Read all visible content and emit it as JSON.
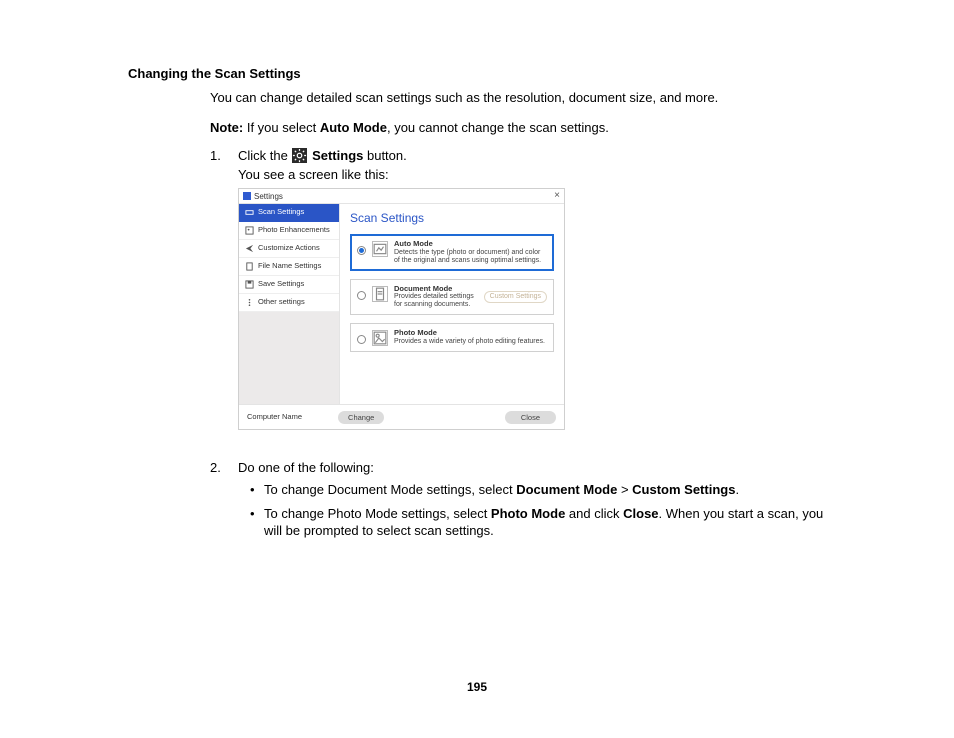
{
  "doc": {
    "heading": "Changing the Scan Settings",
    "intro": "You can change detailed scan settings such as the resolution, document size, and more.",
    "note_label": "Note:",
    "note_before": " If you select ",
    "note_bold": "Auto Mode",
    "note_after": ", you cannot change the scan settings.",
    "step1_num": "1.",
    "step1_a": "Click the ",
    "step1_b": " Settings",
    "step1_c": " button.",
    "step1_sub": "You see a screen like this:",
    "step2_num": "2.",
    "step2": "Do one of the following:",
    "bullet1_a": "To change Document Mode settings, select ",
    "bullet1_b1": "Document Mode",
    "bullet1_mid": " > ",
    "bullet1_b2": "Custom Settings",
    "bullet1_end": ".",
    "bullet2_a": "To change Photo Mode settings, select ",
    "bullet2_b1": "Photo Mode",
    "bullet2_mid": " and click ",
    "bullet2_b2": "Close",
    "bullet2_end": ". When you start a scan, you will be prompted to select scan settings.",
    "page_number": "195"
  },
  "window": {
    "title": "Settings",
    "close_glyph": "×",
    "sidebar": [
      {
        "label": "Scan Settings"
      },
      {
        "label": "Photo Enhancements"
      },
      {
        "label": "Customize Actions"
      },
      {
        "label": "File Name Settings"
      },
      {
        "label": "Save Settings"
      },
      {
        "label": "Other settings"
      }
    ],
    "main_title": "Scan Settings",
    "modes": [
      {
        "title": "Auto Mode",
        "desc": "Detects the type (photo or document) and color of the original and scans using optimal settings."
      },
      {
        "title": "Document Mode",
        "desc": "Provides detailed settings for scanning documents.",
        "custom_settings": "Custom Settings"
      },
      {
        "title": "Photo Mode",
        "desc": "Provides a wide variety of photo editing features."
      }
    ],
    "footer": {
      "computer_name_label": "Computer Name",
      "change": "Change",
      "close": "Close"
    }
  }
}
